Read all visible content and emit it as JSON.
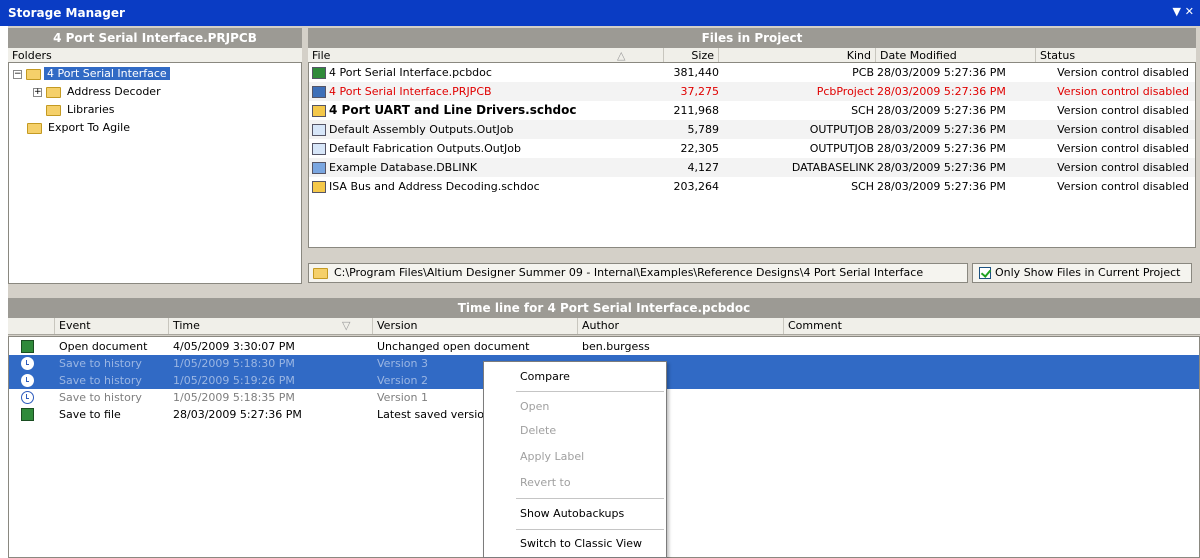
{
  "window": {
    "title": "Storage Manager",
    "controls": "▼ ✕"
  },
  "folders_panel": {
    "header": "4 Port Serial Interface.PRJPCB",
    "column": "Folders",
    "items": [
      {
        "label": "4 Port Serial Interface",
        "expander": "−"
      },
      {
        "label": "Address Decoder",
        "expander": "+"
      },
      {
        "label": "Libraries"
      },
      {
        "label": "Export To Agile"
      }
    ]
  },
  "files_panel": {
    "header": "Files in Project",
    "columns": {
      "file": "File",
      "size": "Size",
      "kind": "Kind",
      "date": "Date Modified",
      "status": "Status"
    },
    "sort_indicator": "△",
    "rows": [
      {
        "name": "4 Port Serial Interface.pcbdoc",
        "size": "381,440",
        "kind": "PCB",
        "date": "28/03/2009 5:27:36 PM",
        "status": "Version control disabled"
      },
      {
        "name": "4 Port Serial Interface.PRJPCB",
        "size": "37,275",
        "kind": "PcbProject",
        "date": "28/03/2009 5:27:36 PM",
        "status": "Version control disabled"
      },
      {
        "name": "4 Port UART and Line Drivers.schdoc",
        "size": "211,968",
        "kind": "SCH",
        "date": "28/03/2009 5:27:36 PM",
        "status": "Version control disabled"
      },
      {
        "name": "Default Assembly Outputs.OutJob",
        "size": "5,789",
        "kind": "OUTPUTJOB",
        "date": "28/03/2009 5:27:36 PM",
        "status": "Version control disabled"
      },
      {
        "name": "Default Fabrication Outputs.OutJob",
        "size": "22,305",
        "kind": "OUTPUTJOB",
        "date": "28/03/2009 5:27:36 PM",
        "status": "Version control disabled"
      },
      {
        "name": "Example Database.DBLINK",
        "size": "4,127",
        "kind": "DATABASELINK",
        "date": "28/03/2009 5:27:36 PM",
        "status": "Version control disabled"
      },
      {
        "name": "ISA Bus and Address Decoding.schdoc",
        "size": "203,264",
        "kind": "SCH",
        "date": "28/03/2009 5:27:36 PM",
        "status": "Version control disabled"
      }
    ],
    "path": "C:\\Program Files\\Altium Designer Summer 09 - Internal\\Examples\\Reference Designs\\4 Port Serial Interface",
    "only_current_label": "Only Show Files in Current Project",
    "only_current_checked": true
  },
  "timeline": {
    "header": "Time line for 4 Port Serial Interface.pcbdoc",
    "columns": {
      "event": "Event",
      "time": "Time",
      "version": "Version",
      "author": "Author",
      "comment": "Comment"
    },
    "sort_indicator": "▽",
    "rows": [
      {
        "event": "Open document",
        "time": "4/05/2009 3:30:07 PM",
        "version": "Unchanged open document",
        "author": "ben.burgess"
      },
      {
        "event": "Save to history",
        "time": "1/05/2009 5:18:30 PM",
        "version": "Version 3",
        "author": ""
      },
      {
        "event": "Save to history",
        "time": "1/05/2009 5:19:26 PM",
        "version": "Version 2",
        "author": ""
      },
      {
        "event": "Save to history",
        "time": "1/05/2009 5:18:35 PM",
        "version": "Version 1",
        "author": ""
      },
      {
        "event": "Save to file",
        "time": "28/03/2009 5:27:36 PM",
        "version": "Latest saved versio",
        "author": ""
      }
    ]
  },
  "context_menu": {
    "items": [
      {
        "label": "Compare",
        "enabled": true
      },
      {
        "label": "Open",
        "enabled": false
      },
      {
        "label": "Delete",
        "enabled": false
      },
      {
        "label": "Apply Label",
        "enabled": false
      },
      {
        "label": "Revert to",
        "enabled": false
      },
      {
        "label": "Show Autobackups",
        "enabled": true
      },
      {
        "label": "Switch to Classic View",
        "enabled": true
      }
    ]
  },
  "colors": {
    "titlebar": "#0a3cc4",
    "panel_header": "#9c9a94",
    "selection": "#316ac5",
    "project_red": "#e00000"
  }
}
